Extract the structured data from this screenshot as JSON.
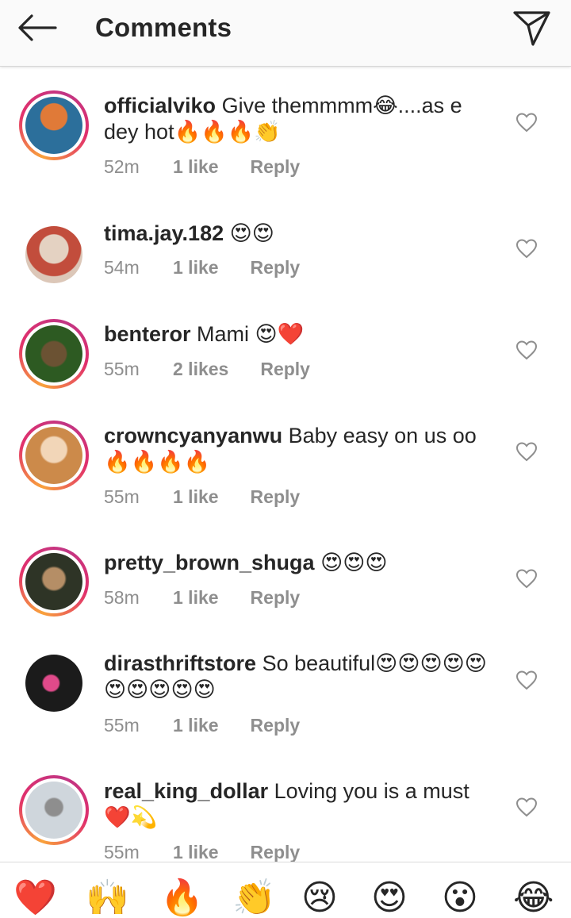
{
  "header": {
    "title": "Comments"
  },
  "comments": [
    {
      "username": "officialviko",
      "text": "Give themmmm😂....as e dey hot🔥🔥🔥👏",
      "time": "52m",
      "likes": "1 like",
      "reply": "Reply",
      "avatar_colors": [
        "#e07a38",
        "#2c6f9b"
      ]
    },
    {
      "username": "tima.jay.182",
      "text": "😍😍",
      "time": "54m",
      "likes": "1 like",
      "reply": "Reply",
      "avatar_colors": [
        "#e4d2c2",
        "#c24d3c"
      ]
    },
    {
      "username": "benteror",
      "text": "Mami 😍❤️",
      "time": "55m",
      "likes": "2 likes",
      "reply": "Reply",
      "avatar_colors": [
        "#2d5a22",
        "#6b5233"
      ]
    },
    {
      "username": "crowncyanyanwu",
      "text": "Baby easy on us oo🔥🔥🔥🔥",
      "time": "55m",
      "likes": "1 like",
      "reply": "Reply",
      "avatar_colors": [
        "#cc8a4a",
        "#f2d6b8"
      ]
    },
    {
      "username": "pretty_brown_shuga",
      "text": "😍😍😍",
      "time": "58m",
      "likes": "1 like",
      "reply": "Reply",
      "avatar_colors": [
        "#2e3426",
        "#b58e66"
      ]
    },
    {
      "username": "dirasthriftstore",
      "text": "So beautiful😍😍😍😍😍😍😍😍😍😍",
      "time": "55m",
      "likes": "1 like",
      "reply": "Reply",
      "avatar_colors": [
        "#1b1b1b",
        "#e04a8a"
      ]
    },
    {
      "username": "real_king_dollar",
      "text": "Loving you is a must ❤️💫",
      "time": "55m",
      "likes": "1 like",
      "reply": "Reply",
      "avatar_colors": [
        "#cfd6dc",
        "#8e8e8e"
      ]
    }
  ],
  "emoji_bar": [
    "❤️",
    "🙌",
    "🔥",
    "👏",
    "😢",
    "😍",
    "😮",
    "😂"
  ],
  "colors": {
    "ring_start": "#f9a23b",
    "ring_end": "#c13584",
    "meta_grey": "#8e8e8e",
    "heart_red": "#e0201f"
  }
}
